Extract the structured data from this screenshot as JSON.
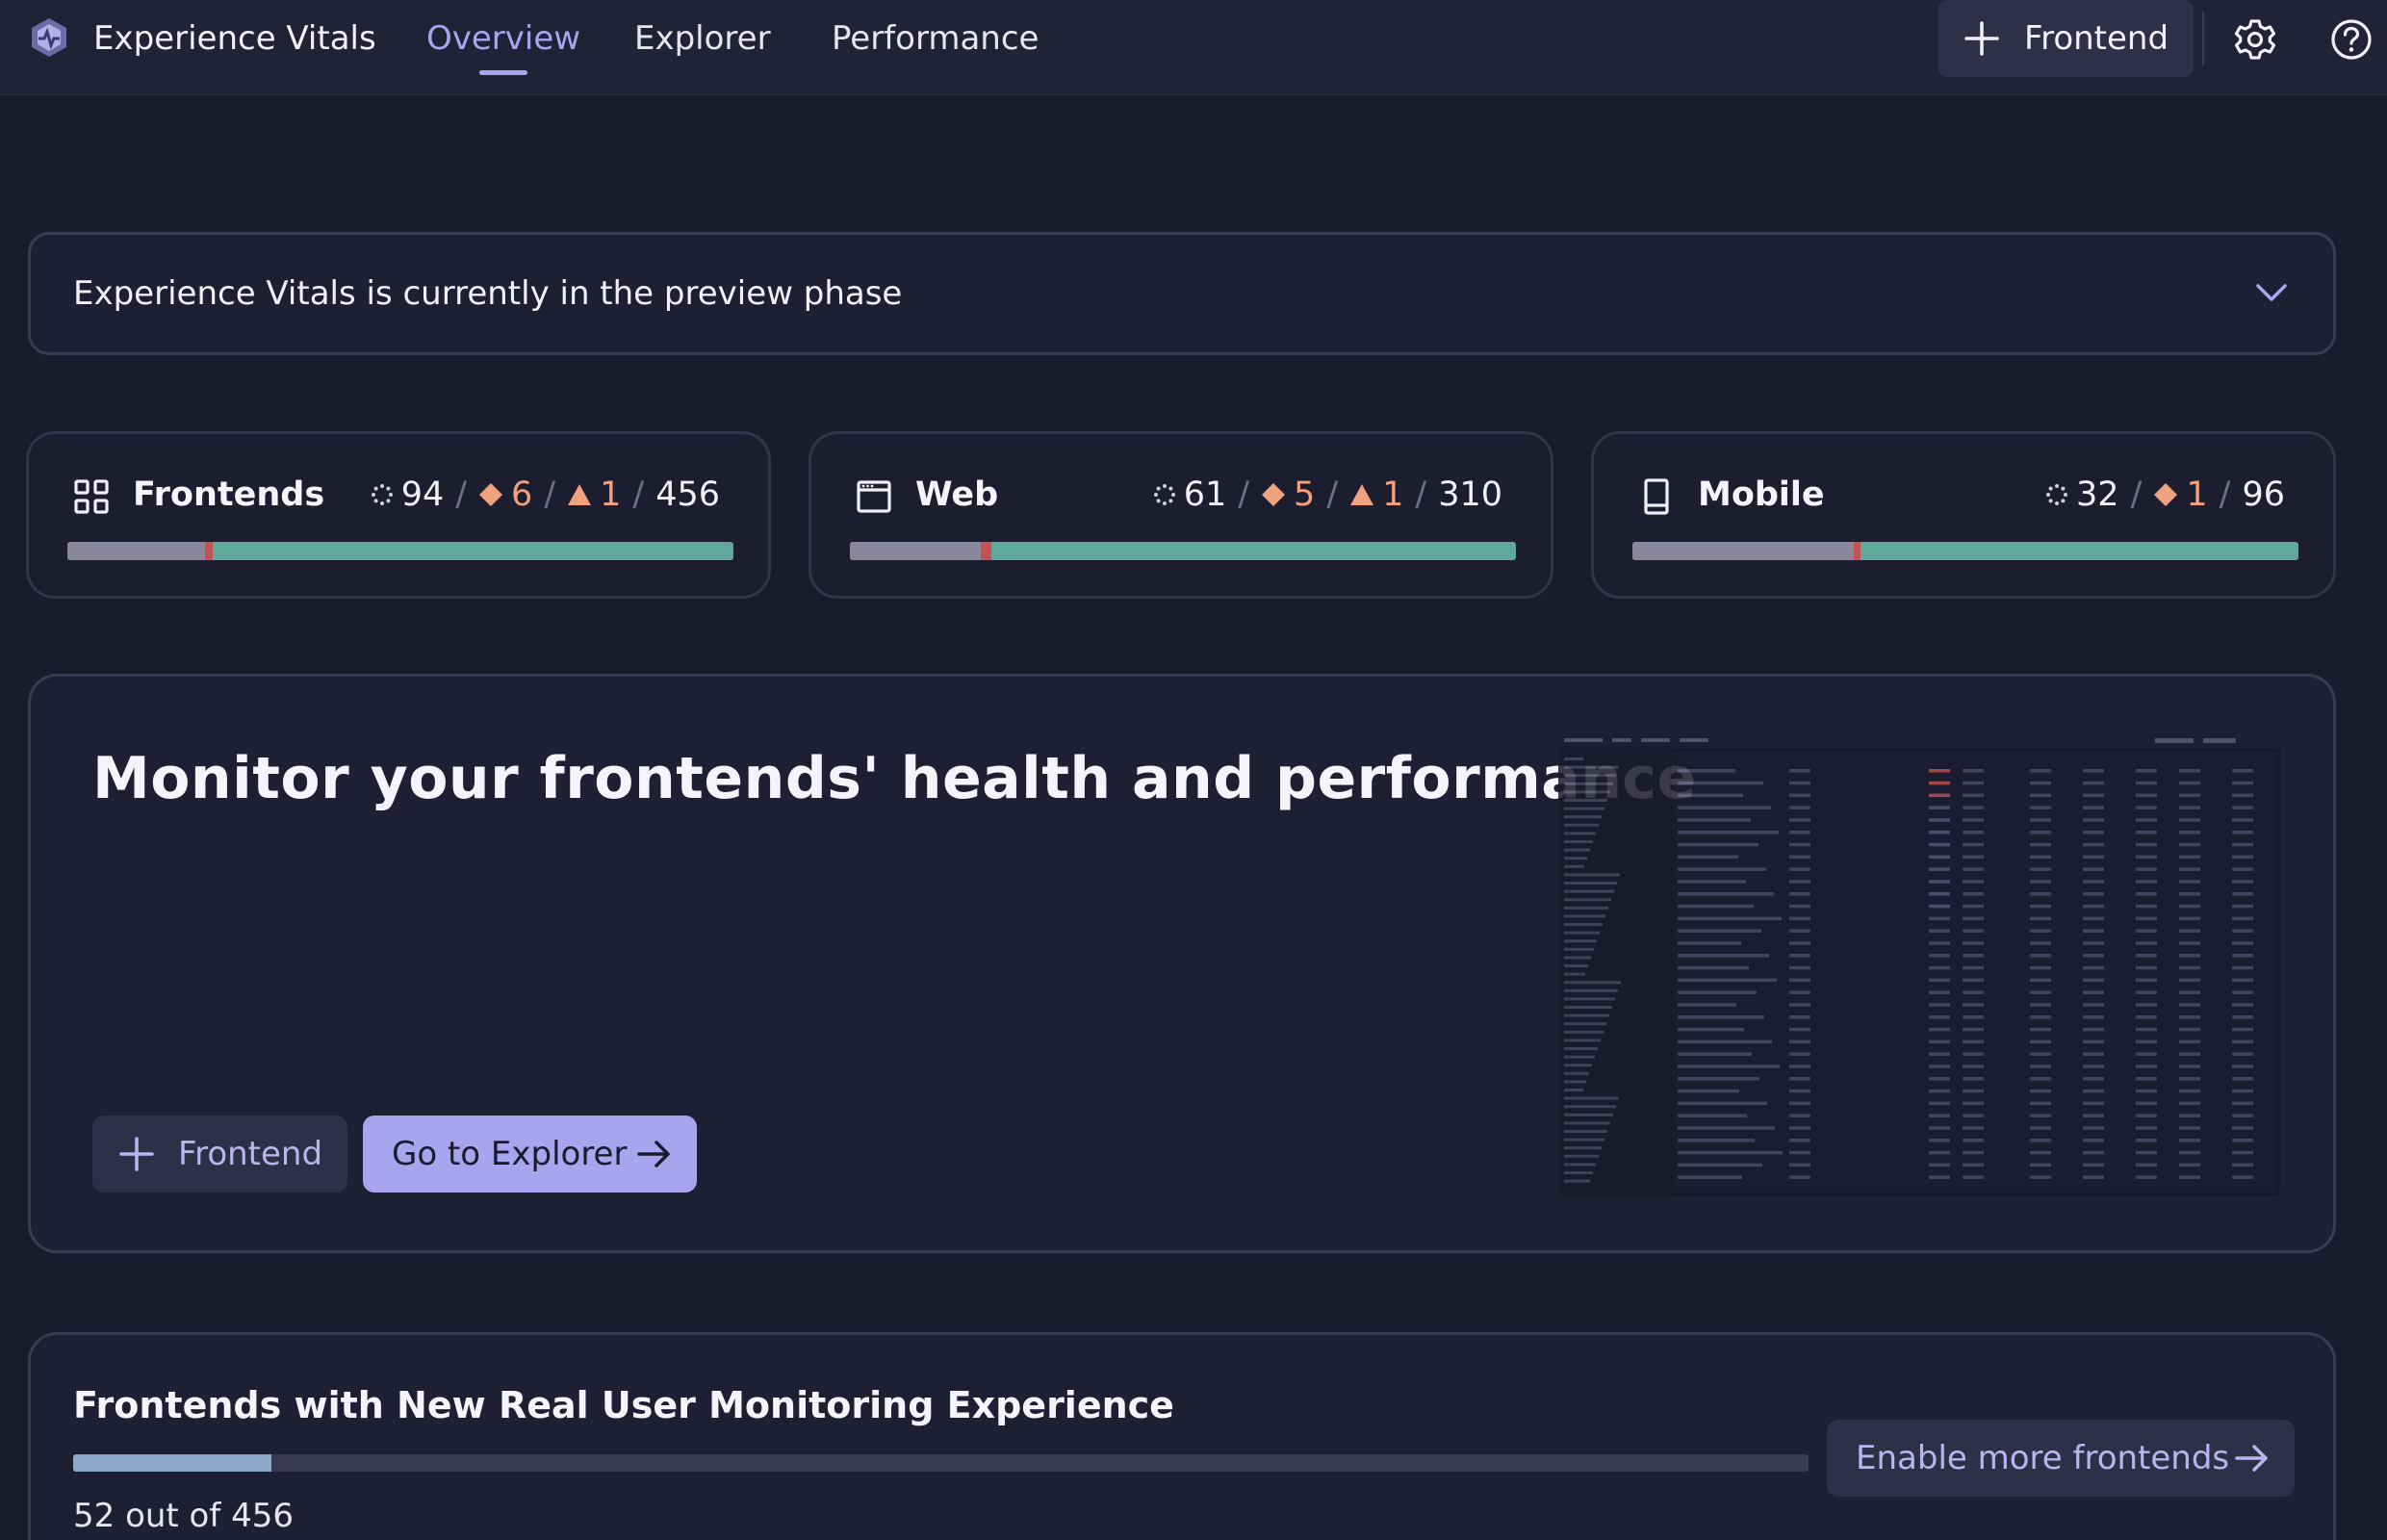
{
  "header": {
    "app_title": "Experience Vitals",
    "tabs": [
      {
        "label": "Overview",
        "active": true
      },
      {
        "label": "Explorer",
        "active": false
      },
      {
        "label": "Performance",
        "active": false
      }
    ],
    "add_button_label": "Frontend",
    "icons": [
      "app-logo-icon",
      "plus-icon",
      "gear-icon",
      "help-icon"
    ]
  },
  "banner": {
    "text": "Experience Vitals is currently in the preview phase"
  },
  "cards": [
    {
      "title": "Frontends",
      "icon": "grid-icon",
      "loading": "94",
      "warnings": "6",
      "alerts": "1",
      "total": "456",
      "bar_gray_fraction": 0.206,
      "bar_red_fraction": 0.012
    },
    {
      "title": "Web",
      "icon": "browser-window-icon",
      "loading": "61",
      "warnings": "5",
      "alerts": "1",
      "total": "310",
      "bar_gray_fraction": 0.197,
      "bar_red_fraction": 0.016
    },
    {
      "title": "Mobile",
      "icon": "mobile-device-icon",
      "loading": "32",
      "warnings": "1",
      "total": "96",
      "bar_gray_fraction": 0.333,
      "bar_red_fraction": 0.01
    }
  ],
  "hero": {
    "title": "Monitor your frontends' health and performance",
    "add_frontend_label": "Frontend",
    "explorer_label": "Go to Explorer"
  },
  "adoption": {
    "title": "Frontends with New Real User Monitoring Experience",
    "count_text": "52 out of 456",
    "enabled": 52,
    "total": 456,
    "enable_button_label": "Enable more frontends"
  },
  "colors": {
    "background": "#1b1b2e",
    "accent": "#a9a4ee",
    "healthy": "#5fa89b",
    "neutral": "#8a879c",
    "problem": "#c45252",
    "warning": "#f0a17e"
  }
}
